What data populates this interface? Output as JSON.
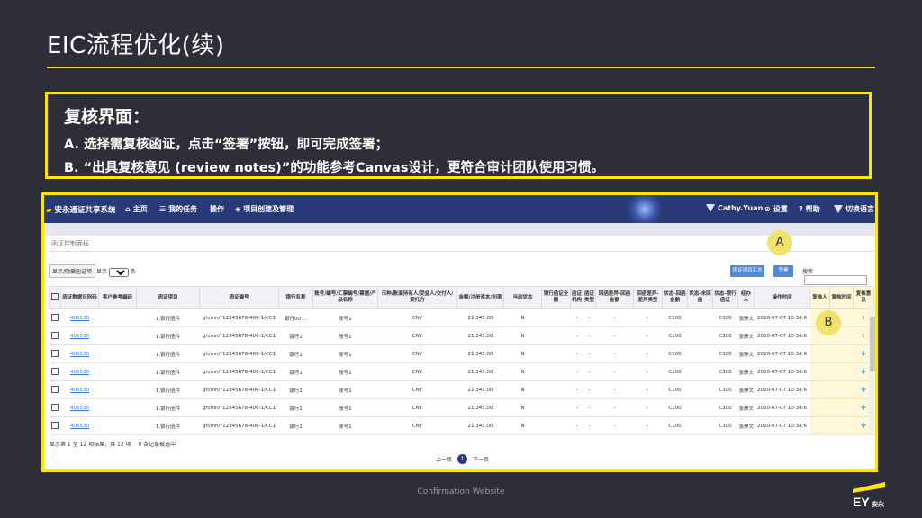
{
  "slide": {
    "title": "EIC流程优化(续)",
    "heading": "复核界面：",
    "item_a": "A.  选择需复核函证，点击“签署”按钮，即可完成签署；",
    "item_b": "B. “出具复核意见 (review notes)”的功能参考Canvas设计，更符合审计团队使用习惯。",
    "footer": "Confirmation Website",
    "logo_text": "EY",
    "logo_cn": "安永"
  },
  "app": {
    "brand": "安永通证共享系统",
    "nav": [
      "主页",
      "我的任务",
      "操作",
      "项目创建及管理"
    ],
    "user": "Cathy.Yuan",
    "settings": "设置",
    "help": "帮助",
    "language": "切换语言",
    "breadcrumb": "函证控制面板",
    "show_hide_btn": "显示/隐藏函证项",
    "show_label": "显示",
    "show_value": "100",
    "show_suffix": "条",
    "btn_summary": "函证项目汇总",
    "btn_sign": "签署",
    "search_label": "搜索",
    "markers": {
      "a": "A",
      "b": "B"
    },
    "columns": [
      "",
      "函证数据识别码",
      "客户参考编码",
      "函证项目",
      "函证编号",
      "银行名称",
      "账号/编号/汇票编号/票据/产品名称",
      "币种/账面持有人/受益人/交付人/受托方",
      "金额/注册资本/利率",
      "当前状态",
      "银行函证全额",
      "函证机构",
      "函证类型",
      "回函差异-回函金额",
      "回函差异-差异类型",
      "状态-回函金额",
      "状态-未回函",
      "状态-银行函证",
      "经办人",
      "操作时间",
      "复核人",
      "复核时间",
      "复核意见"
    ],
    "rows": [
      {
        "id": "405530",
        "item": "1.银行函件",
        "no": "gh/mn/*12345678-406-1/CC1",
        "bank": "银行00 ...",
        "acct": "账号1",
        "cur": "CNY",
        "amt": "21,345.00",
        "status": "N",
        "d1": "-",
        "d2": "-",
        "d3": "-",
        "d4": "-",
        "c1": "C100",
        "c2": "C300",
        "user": "张静文",
        "time": "2020-07-07 10:34:6",
        "review": "2"
      },
      {
        "id": "405530",
        "item": "1.银行函件",
        "no": "gh/mn/*12345678-406-1/CC1",
        "bank": "银行1",
        "acct": "账号1",
        "cur": "CNY",
        "amt": "21,345.00",
        "status": "N",
        "d1": "-",
        "d2": "-",
        "d3": "-",
        "d4": "-",
        "c1": "C100",
        "c2": "C300",
        "user": "张静文",
        "time": "2020-07-07 10:34:6",
        "review": "1"
      },
      {
        "id": "405530",
        "item": "1.银行函件",
        "no": "gh/mn/*12345678-406-1/CC1",
        "bank": "银行1",
        "acct": "账号1",
        "cur": "CNY",
        "amt": "21,345.00",
        "status": "N",
        "d1": "-",
        "d2": "-",
        "d3": "-",
        "d4": "-",
        "c1": "C100",
        "c2": "C300",
        "user": "张静文",
        "time": "2020-07-07 10:34:6",
        "review": "+"
      },
      {
        "id": "405530",
        "item": "1.银行函件",
        "no": "gh/mn/*12345678-406-1/CC1",
        "bank": "银行1",
        "acct": "账号1",
        "cur": "CNY",
        "amt": "21,345.00",
        "status": "N",
        "d1": "-",
        "d2": "-",
        "d3": "-",
        "d4": "-",
        "c1": "C100",
        "c2": "C300",
        "user": "张静文",
        "time": "2020-07-07 10:34:6",
        "review": "+"
      },
      {
        "id": "405530",
        "item": "1.银行函件",
        "no": "gh/mn/*12345678-406-1/CC1",
        "bank": "银行1",
        "acct": "账号1",
        "cur": "CNY",
        "amt": "21,345.00",
        "status": "N",
        "d1": "-",
        "d2": "-",
        "d3": "-",
        "d4": "-",
        "c1": "C100",
        "c2": "C300",
        "user": "张静文",
        "time": "2020-07-07 10:34:6",
        "review": "+"
      },
      {
        "id": "405530",
        "item": "1.银行函件",
        "no": "gh/mn/*12345678-406-1/CC1",
        "bank": "银行1",
        "acct": "账号1",
        "cur": "CNY",
        "amt": "21,345.00",
        "status": "N",
        "d1": "-",
        "d2": "-",
        "d3": "-",
        "d4": "-",
        "c1": "C100",
        "c2": "C300",
        "user": "张静文",
        "time": "2020-07-07 10:34:6",
        "review": "+"
      },
      {
        "id": "405530",
        "item": "1.银行函件",
        "no": "gh/mn/*12345678-406-1/CC1",
        "bank": "银行1",
        "acct": "账号1",
        "cur": "CNY",
        "amt": "21,345.00",
        "status": "N",
        "d1": "-",
        "d2": "-",
        "d3": "-",
        "d4": "-",
        "c1": "C100",
        "c2": "C300",
        "user": "张静文",
        "time": "2020-07-07 10:34:6",
        "review": "+"
      }
    ],
    "table_info": "显示第 1 至 12 项结果，共 12 项",
    "selected_info": "0 条记录被选中",
    "pager_prev": "上一页",
    "pager_current": "1",
    "pager_next": "下一页"
  },
  "colors": {
    "background": "#2e2e38",
    "accent": "#ffe600",
    "appbar": "#2a3977",
    "link": "#3a7bd5",
    "marker": "#f1e26c"
  },
  "icons": [
    "home-icon",
    "task-icon",
    "project-icon",
    "user-icon",
    "settings-icon",
    "help-icon",
    "language-icon",
    "plus-icon",
    "ey-logo"
  ]
}
